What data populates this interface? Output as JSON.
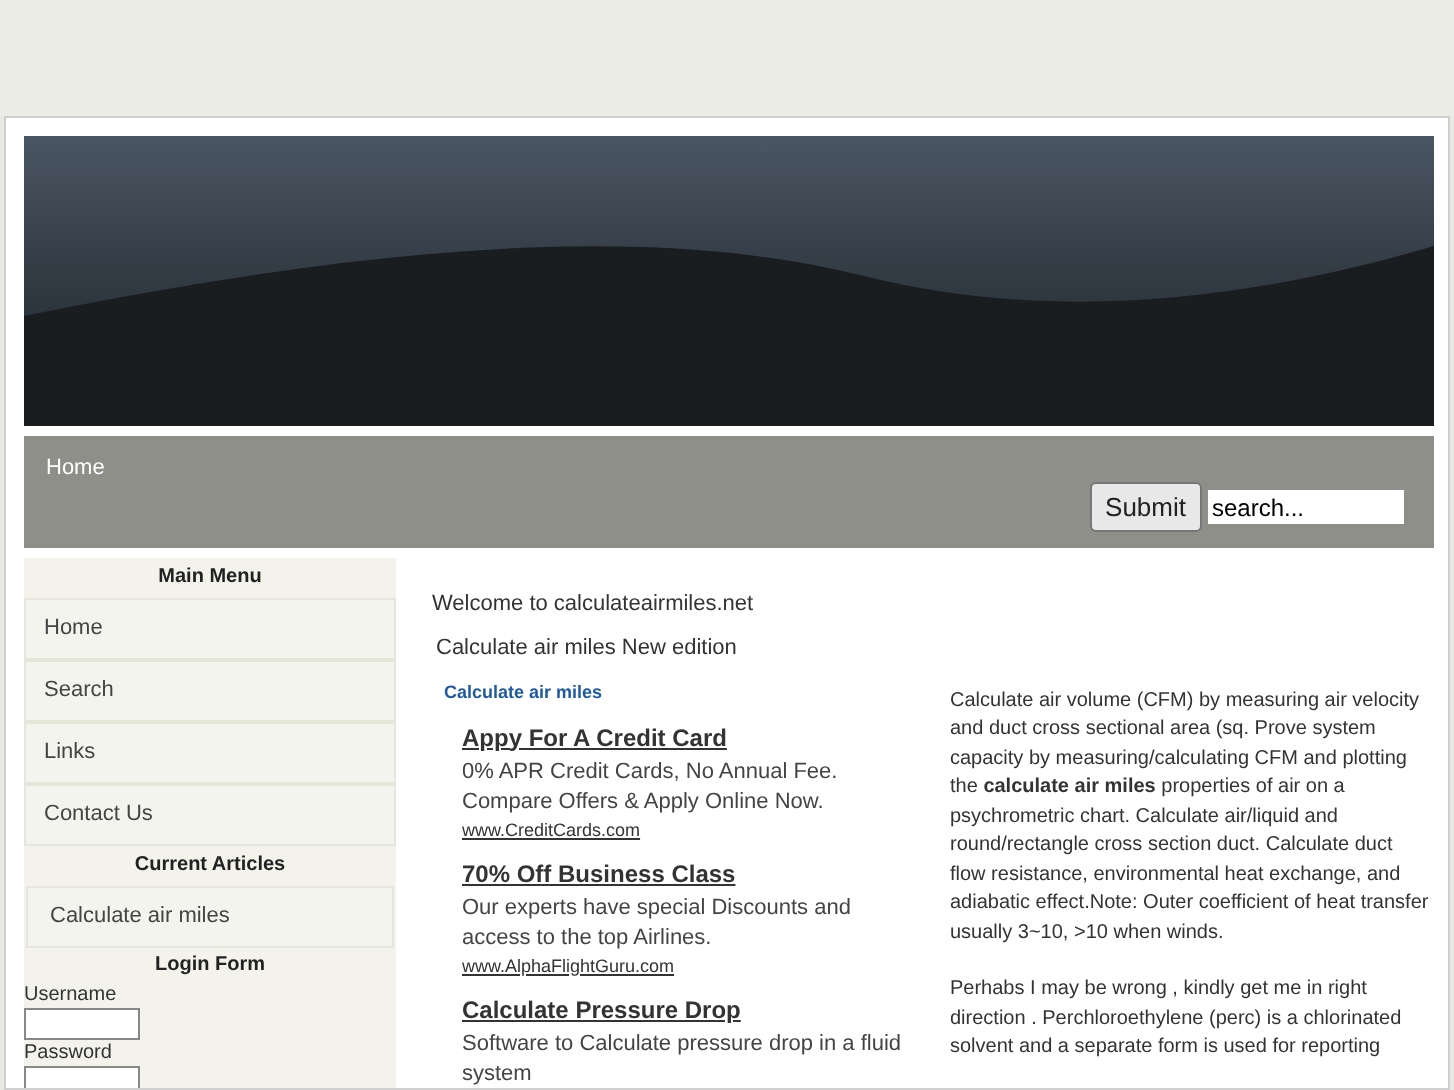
{
  "nav": {
    "items": [
      {
        "label": "Home"
      }
    ],
    "submit": "Submit",
    "search": {
      "value": "search..."
    }
  },
  "sidebar": {
    "sections": [
      {
        "title": "Main Menu",
        "items": [
          "Home",
          "Search",
          "Links",
          "Contact Us"
        ]
      },
      {
        "title": "Current Articles",
        "items": [
          "Calculate air miles"
        ]
      }
    ],
    "login": {
      "title": "Login Form",
      "fields": [
        "Username",
        "Password"
      ]
    }
  },
  "main": {
    "welcome": "Welcome to calculateairmiles.net",
    "subtitle": "Calculate air miles New edition",
    "article_link": "Calculate air miles",
    "ads": [
      {
        "title": "Appy For A Credit Card",
        "text": "0% APR Credit Cards, No Annual Fee. Compare Offers & Apply Online Now.",
        "url": "www.CreditCards.com"
      },
      {
        "title": "70% Off Business Class",
        "text": "Our experts have special Discounts and access to the top Airlines.",
        "url": "www.AlphaFlightGuru.com"
      },
      {
        "title": "Calculate Pressure Drop",
        "text": "Software to Calculate pressure drop in a fluid system"
      }
    ],
    "paragraphs": [
      "Calculate air volume (CFM) by measuring air velocity and duct cross sectional area (sq. Prove system capacity by measuring/calculating CFM and plotting the **calculate air miles** properties of air on a psychrometric chart. Calculate air/liquid and round/rectangle cross section duct. Calculate duct flow resistance, environmental heat exchange, and adiabatic effect.Note: Outer coefficient of heat transfer usually 3~10, >10 when winds.",
      "Perhabs I may be wrong , kindly get me in right direction . Perchloroethylene (perc) is a chlorinated solvent and a separate form is used for reporting"
    ]
  }
}
